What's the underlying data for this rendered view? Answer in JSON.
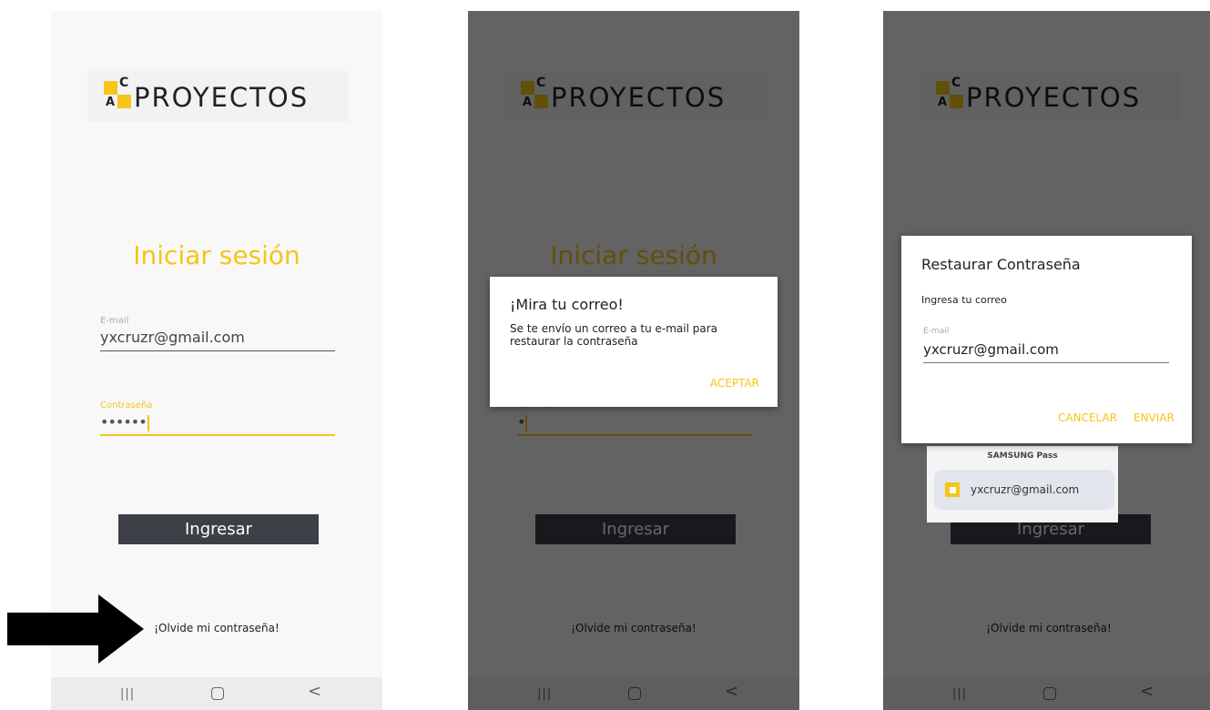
{
  "logo": {
    "letter_c": "C",
    "letter_a": "A",
    "text": "PROYECTOS"
  },
  "login": {
    "title": "Iniciar sesión",
    "email_label": "E-mail",
    "email_value": "yxcruzr@gmail.com",
    "password_label": "Contraseña",
    "password_value_screen1": "••••••",
    "password_value_screen2": "•",
    "login_button": "Ingresar",
    "forgot_link": "¡Olvide mi contraseña!"
  },
  "navbar": {
    "recents": "|||",
    "back": "<"
  },
  "check_mail_dialog": {
    "title": "¡Mira tu correo!",
    "message": "Se te envío un correo a tu e-mail para restaurar la contraseña",
    "accept_button": "ACEPTAR"
  },
  "restore_dialog": {
    "title": "Restaurar Contraseña",
    "subtitle": "Ingresa tu correo",
    "email_label": "E-mail",
    "email_value": "yxcruzr@gmail.com",
    "cancel_button": "CANCELAR",
    "send_button": "ENVIAR"
  },
  "samsung_pass": {
    "header": "SAMSUNG Pass",
    "account_email": "yxcruzr@gmail.com"
  },
  "colors": {
    "accent": "#f5c518",
    "button_bg": "#3d4047",
    "background": "#f8f8f8"
  },
  "annotation": {
    "icon": "arrow-right-icon"
  }
}
